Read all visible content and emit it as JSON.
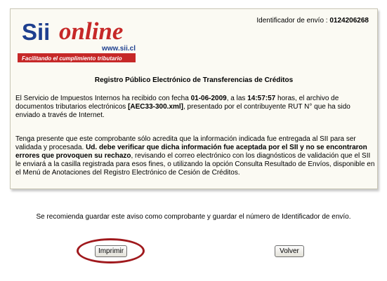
{
  "header": {
    "logo_text_sii": "Sii",
    "logo_text_online": "online",
    "logo_url": "www.sii.cl",
    "logo_tagline": "Facilitando el cumplimiento tributario",
    "envio_label": "Identificador de envío :",
    "envio_value": "0124206268"
  },
  "receipt": {
    "title": "Registro Público Electrónico de Transferencias de Créditos",
    "p1": {
      "t1": "El Servicio de Impuestos Internos ha recibido con fecha ",
      "date": "01-06-2009",
      "t2": ", a las ",
      "time": "14:57:57",
      "t3": " horas, el archivo de documentos tributarios electrónicos ",
      "file": "[AEC33-300.xml]",
      "t4": ", presentado por el contribuyente RUT N° que ha sido enviado a través de Internet."
    },
    "p2": {
      "t1": "Tenga presente que este comprobante sólo acredita que la información indicada fue entregada al SII para ser validada y procesada. ",
      "bold": "Ud. debe verificar que dicha información fue aceptada por el SII y no se encontraron errores que provoquen su rechazo",
      "t2": ", revisando el correo electrónico con los diagnósticos de validación que el SII le enviará a la casilla registrada para esos fines, o utilizando la opción Consulta Resultado de Envíos, disponible en el Menú de Anotaciones del Registro Electrónico de Cesión de Créditos."
    }
  },
  "advice": "Se recomienda guardar este aviso como comprobante y guardar el número de Identificador de envío.",
  "buttons": {
    "print": "Imprimir",
    "back": "Volver"
  },
  "colors": {
    "logo_blue": "#1e3f8f",
    "logo_red": "#c62828",
    "highlight": "#a0191d"
  }
}
